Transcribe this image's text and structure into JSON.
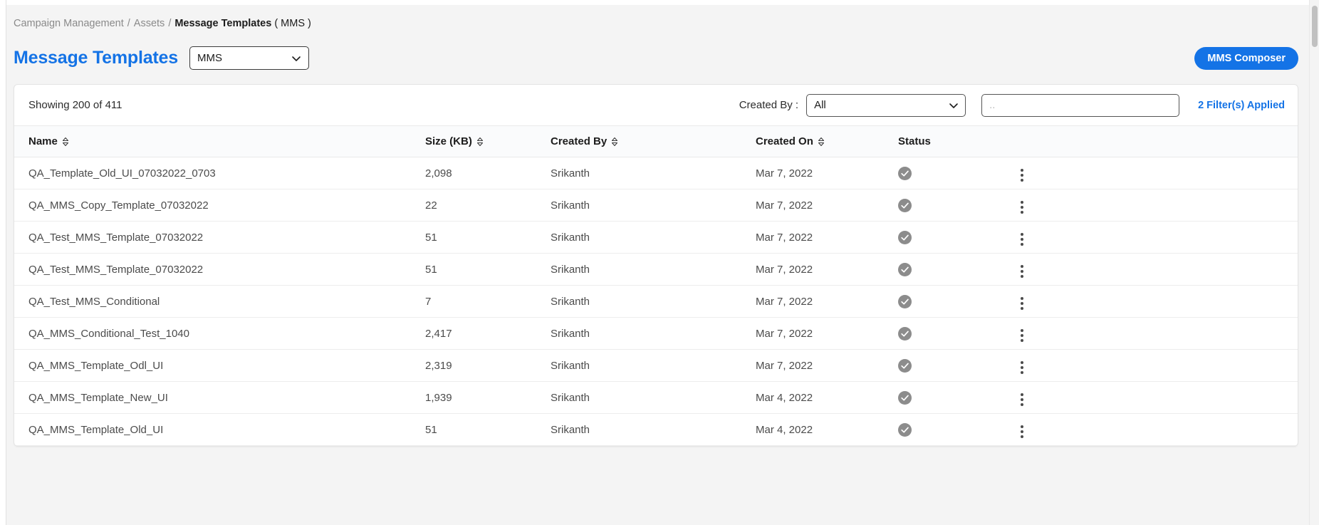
{
  "breadcrumb": {
    "items": [
      "Campaign Management",
      "Assets"
    ],
    "separator": "/",
    "current": "Message Templates",
    "current_suffix": "( MMS )"
  },
  "header": {
    "title": "Message Templates",
    "type_select": {
      "value": "MMS",
      "icon": "chevron-down-icon"
    },
    "composer_button": "MMS Composer",
    "accent_color": "#1473e6"
  },
  "filters": {
    "showing": "Showing 200 of 411",
    "created_by_label": "Created By :",
    "created_by_value": "All",
    "created_by_icon": "chevron-down-icon",
    "search_placeholder": "..",
    "search_value": "",
    "filters_applied": "2 Filter(s) Applied"
  },
  "table": {
    "columns": [
      {
        "label": "Name",
        "sortable": true,
        "sort_icon": "sort-updown-icon"
      },
      {
        "label": "Size (KB)",
        "sortable": true,
        "sort_icon": "sort-updown-icon"
      },
      {
        "label": "Created By",
        "sortable": true,
        "sort_icon": "sort-updown-icon"
      },
      {
        "label": "Created On",
        "sortable": true,
        "sort_icon": "sort-updown-icon"
      },
      {
        "label": "Status",
        "sortable": false,
        "sort_icon": ""
      }
    ],
    "status_icon": "check-circle-icon",
    "row_menu_icon": "kebab-menu-icon",
    "rows": [
      {
        "name": "QA_Template_Old_UI_07032022_0703",
        "size": "2,098",
        "created_by": "Srikanth",
        "created_on": "Mar 7, 2022",
        "status": "active"
      },
      {
        "name": "QA_MMS_Copy_Template_07032022",
        "size": "22",
        "created_by": "Srikanth",
        "created_on": "Mar 7, 2022",
        "status": "active"
      },
      {
        "name": "QA_Test_MMS_Template_07032022",
        "size": "51",
        "created_by": "Srikanth",
        "created_on": "Mar 7, 2022",
        "status": "active"
      },
      {
        "name": "QA_Test_MMS_Template_07032022",
        "size": "51",
        "created_by": "Srikanth",
        "created_on": "Mar 7, 2022",
        "status": "active"
      },
      {
        "name": "QA_Test_MMS_Conditional",
        "size": "7",
        "created_by": "Srikanth",
        "created_on": "Mar 7, 2022",
        "status": "active"
      },
      {
        "name": "QA_MMS_Conditional_Test_1040",
        "size": "2,417",
        "created_by": "Srikanth",
        "created_on": "Mar 7, 2022",
        "status": "active"
      },
      {
        "name": "QA_MMS_Template_Odl_UI",
        "size": "2,319",
        "created_by": "Srikanth",
        "created_on": "Mar 7, 2022",
        "status": "active"
      },
      {
        "name": "QA_MMS_Template_New_UI",
        "size": "1,939",
        "created_by": "Srikanth",
        "created_on": "Mar 4, 2022",
        "status": "active"
      },
      {
        "name": "QA_MMS_Template_Old_UI",
        "size": "51",
        "created_by": "Srikanth",
        "created_on": "Mar 4, 2022",
        "status": "active"
      }
    ]
  }
}
